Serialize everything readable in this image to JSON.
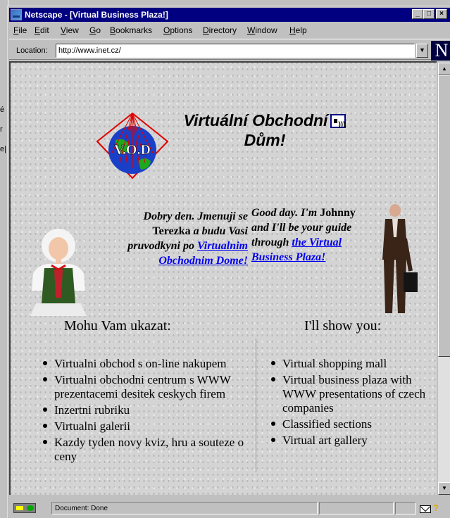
{
  "desktop": {
    "fragments": [
      "é",
      "r",
      "e|"
    ]
  },
  "window": {
    "title": "Netscape - [Virtual Business Plaza!]",
    "controls": {
      "minimize": "_",
      "maximize": "□",
      "close": "×"
    }
  },
  "menu": {
    "items": [
      "File",
      "Edit",
      "View",
      "Go",
      "Bookmarks",
      "Options",
      "Directory",
      "Window",
      "Help"
    ]
  },
  "location": {
    "label": "Location:",
    "url": "http://www.inet.cz/",
    "dropdown": "▼",
    "logo": "N"
  },
  "page": {
    "logo_text": "V.O.D",
    "heading_line1": "Virtuální Obchodní",
    "heading_line2": "Dům!",
    "czech_greeting": {
      "part1": "Dobry den. Jmenuji se ",
      "name": "Terezka",
      "part2": " a budu Vasi pruvodkyni po ",
      "link": "Virtualnim Obchodnim Dome!"
    },
    "english_greeting": {
      "part1": "Good day. I'm ",
      "name": "Johnny",
      "part2": " and I'll be your guide through ",
      "link": "the Virtual Business Plaza!"
    },
    "czech_list": {
      "heading": "Mohu Vam ukazat:",
      "items": [
        "Virtualni obchod s on-line nakupem",
        "Virtualni obchodni centrum s WWW prezentacemi desitek ceskych firem",
        "Inzertni rubriku",
        "Virtualni galerii",
        "Kazdy tyden novy kviz, hru a souteze o ceny"
      ]
    },
    "english_list": {
      "heading": "I'll show you:",
      "items": [
        "Virtual shopping mall",
        "Virtual business plaza with WWW presentations of czech companies",
        "Classified sections",
        "Virtual art gallery"
      ]
    }
  },
  "scrollbar": {
    "up": "▲",
    "down": "▼",
    "position": 0
  },
  "status": {
    "text": "Document: Done",
    "help": "?"
  },
  "colors": {
    "titlebar": "#000080",
    "link": "#0000ee",
    "logo_globe": "#1a3fc8",
    "logo_border": "#e00000",
    "chrome": "#c0c0c0"
  }
}
